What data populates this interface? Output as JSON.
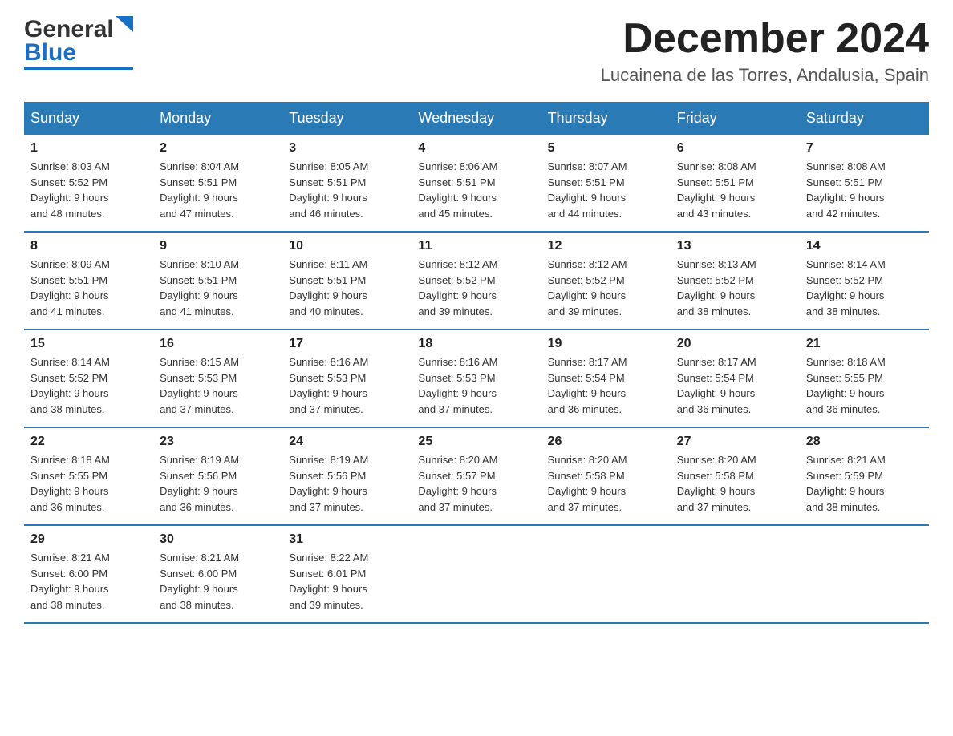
{
  "header": {
    "logo_general": "General",
    "logo_blue": "Blue",
    "month_title": "December 2024",
    "location": "Lucainena de las Torres, Andalusia, Spain"
  },
  "days_of_week": [
    "Sunday",
    "Monday",
    "Tuesday",
    "Wednesday",
    "Thursday",
    "Friday",
    "Saturday"
  ],
  "weeks": [
    [
      {
        "day": "1",
        "sunrise": "Sunrise: 8:03 AM",
        "sunset": "Sunset: 5:52 PM",
        "daylight": "Daylight: 9 hours",
        "daylight2": "and 48 minutes."
      },
      {
        "day": "2",
        "sunrise": "Sunrise: 8:04 AM",
        "sunset": "Sunset: 5:51 PM",
        "daylight": "Daylight: 9 hours",
        "daylight2": "and 47 minutes."
      },
      {
        "day": "3",
        "sunrise": "Sunrise: 8:05 AM",
        "sunset": "Sunset: 5:51 PM",
        "daylight": "Daylight: 9 hours",
        "daylight2": "and 46 minutes."
      },
      {
        "day": "4",
        "sunrise": "Sunrise: 8:06 AM",
        "sunset": "Sunset: 5:51 PM",
        "daylight": "Daylight: 9 hours",
        "daylight2": "and 45 minutes."
      },
      {
        "day": "5",
        "sunrise": "Sunrise: 8:07 AM",
        "sunset": "Sunset: 5:51 PM",
        "daylight": "Daylight: 9 hours",
        "daylight2": "and 44 minutes."
      },
      {
        "day": "6",
        "sunrise": "Sunrise: 8:08 AM",
        "sunset": "Sunset: 5:51 PM",
        "daylight": "Daylight: 9 hours",
        "daylight2": "and 43 minutes."
      },
      {
        "day": "7",
        "sunrise": "Sunrise: 8:08 AM",
        "sunset": "Sunset: 5:51 PM",
        "daylight": "Daylight: 9 hours",
        "daylight2": "and 42 minutes."
      }
    ],
    [
      {
        "day": "8",
        "sunrise": "Sunrise: 8:09 AM",
        "sunset": "Sunset: 5:51 PM",
        "daylight": "Daylight: 9 hours",
        "daylight2": "and 41 minutes."
      },
      {
        "day": "9",
        "sunrise": "Sunrise: 8:10 AM",
        "sunset": "Sunset: 5:51 PM",
        "daylight": "Daylight: 9 hours",
        "daylight2": "and 41 minutes."
      },
      {
        "day": "10",
        "sunrise": "Sunrise: 8:11 AM",
        "sunset": "Sunset: 5:51 PM",
        "daylight": "Daylight: 9 hours",
        "daylight2": "and 40 minutes."
      },
      {
        "day": "11",
        "sunrise": "Sunrise: 8:12 AM",
        "sunset": "Sunset: 5:52 PM",
        "daylight": "Daylight: 9 hours",
        "daylight2": "and 39 minutes."
      },
      {
        "day": "12",
        "sunrise": "Sunrise: 8:12 AM",
        "sunset": "Sunset: 5:52 PM",
        "daylight": "Daylight: 9 hours",
        "daylight2": "and 39 minutes."
      },
      {
        "day": "13",
        "sunrise": "Sunrise: 8:13 AM",
        "sunset": "Sunset: 5:52 PM",
        "daylight": "Daylight: 9 hours",
        "daylight2": "and 38 minutes."
      },
      {
        "day": "14",
        "sunrise": "Sunrise: 8:14 AM",
        "sunset": "Sunset: 5:52 PM",
        "daylight": "Daylight: 9 hours",
        "daylight2": "and 38 minutes."
      }
    ],
    [
      {
        "day": "15",
        "sunrise": "Sunrise: 8:14 AM",
        "sunset": "Sunset: 5:52 PM",
        "daylight": "Daylight: 9 hours",
        "daylight2": "and 38 minutes."
      },
      {
        "day": "16",
        "sunrise": "Sunrise: 8:15 AM",
        "sunset": "Sunset: 5:53 PM",
        "daylight": "Daylight: 9 hours",
        "daylight2": "and 37 minutes."
      },
      {
        "day": "17",
        "sunrise": "Sunrise: 8:16 AM",
        "sunset": "Sunset: 5:53 PM",
        "daylight": "Daylight: 9 hours",
        "daylight2": "and 37 minutes."
      },
      {
        "day": "18",
        "sunrise": "Sunrise: 8:16 AM",
        "sunset": "Sunset: 5:53 PM",
        "daylight": "Daylight: 9 hours",
        "daylight2": "and 37 minutes."
      },
      {
        "day": "19",
        "sunrise": "Sunrise: 8:17 AM",
        "sunset": "Sunset: 5:54 PM",
        "daylight": "Daylight: 9 hours",
        "daylight2": "and 36 minutes."
      },
      {
        "day": "20",
        "sunrise": "Sunrise: 8:17 AM",
        "sunset": "Sunset: 5:54 PM",
        "daylight": "Daylight: 9 hours",
        "daylight2": "and 36 minutes."
      },
      {
        "day": "21",
        "sunrise": "Sunrise: 8:18 AM",
        "sunset": "Sunset: 5:55 PM",
        "daylight": "Daylight: 9 hours",
        "daylight2": "and 36 minutes."
      }
    ],
    [
      {
        "day": "22",
        "sunrise": "Sunrise: 8:18 AM",
        "sunset": "Sunset: 5:55 PM",
        "daylight": "Daylight: 9 hours",
        "daylight2": "and 36 minutes."
      },
      {
        "day": "23",
        "sunrise": "Sunrise: 8:19 AM",
        "sunset": "Sunset: 5:56 PM",
        "daylight": "Daylight: 9 hours",
        "daylight2": "and 36 minutes."
      },
      {
        "day": "24",
        "sunrise": "Sunrise: 8:19 AM",
        "sunset": "Sunset: 5:56 PM",
        "daylight": "Daylight: 9 hours",
        "daylight2": "and 37 minutes."
      },
      {
        "day": "25",
        "sunrise": "Sunrise: 8:20 AM",
        "sunset": "Sunset: 5:57 PM",
        "daylight": "Daylight: 9 hours",
        "daylight2": "and 37 minutes."
      },
      {
        "day": "26",
        "sunrise": "Sunrise: 8:20 AM",
        "sunset": "Sunset: 5:58 PM",
        "daylight": "Daylight: 9 hours",
        "daylight2": "and 37 minutes."
      },
      {
        "day": "27",
        "sunrise": "Sunrise: 8:20 AM",
        "sunset": "Sunset: 5:58 PM",
        "daylight": "Daylight: 9 hours",
        "daylight2": "and 37 minutes."
      },
      {
        "day": "28",
        "sunrise": "Sunrise: 8:21 AM",
        "sunset": "Sunset: 5:59 PM",
        "daylight": "Daylight: 9 hours",
        "daylight2": "and 38 minutes."
      }
    ],
    [
      {
        "day": "29",
        "sunrise": "Sunrise: 8:21 AM",
        "sunset": "Sunset: 6:00 PM",
        "daylight": "Daylight: 9 hours",
        "daylight2": "and 38 minutes."
      },
      {
        "day": "30",
        "sunrise": "Sunrise: 8:21 AM",
        "sunset": "Sunset: 6:00 PM",
        "daylight": "Daylight: 9 hours",
        "daylight2": "and 38 minutes."
      },
      {
        "day": "31",
        "sunrise": "Sunrise: 8:22 AM",
        "sunset": "Sunset: 6:01 PM",
        "daylight": "Daylight: 9 hours",
        "daylight2": "and 39 minutes."
      },
      null,
      null,
      null,
      null
    ]
  ]
}
